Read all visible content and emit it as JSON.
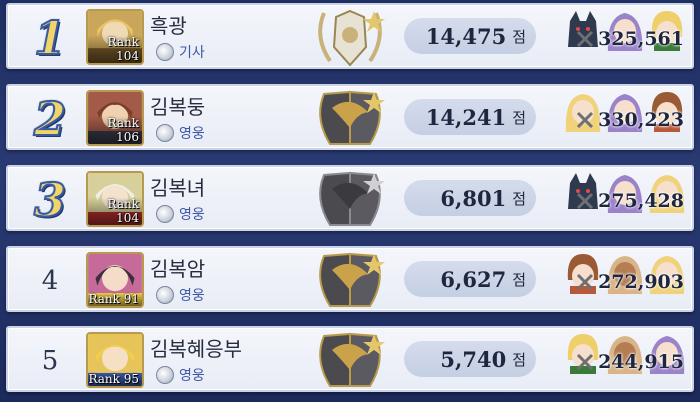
{
  "entries": [
    {
      "rank": "1",
      "name": "흑광",
      "title": "기사",
      "rank_label": "Rank 104",
      "score": "14,475",
      "unit": "점",
      "power": "325,561",
      "emblem": "gold-silver-crest",
      "party": [
        "dark-wolf-knight",
        "purple-hair-girl",
        "blonde-boy"
      ]
    },
    {
      "rank": "2",
      "name": "김복둥",
      "title": "영웅",
      "rank_label": "Rank 106",
      "score": "14,241",
      "unit": "점",
      "power": "330,223",
      "emblem": "dark-gold-crest",
      "party": [
        "blonde-girl",
        "purple-hair-girl",
        "brown-hair-boy"
      ]
    },
    {
      "rank": "3",
      "name": "김복녀",
      "title": "영웅",
      "rank_label": "Rank 104",
      "score": "6,801",
      "unit": "점",
      "power": "275,428",
      "emblem": "dark-gold-crest",
      "party": [
        "dark-wolf-knight",
        "purple-hair-girl",
        "blonde-girl"
      ]
    },
    {
      "rank": "4",
      "name": "김복암",
      "title": "영웅",
      "rank_label": "Rank 91",
      "score": "6,627",
      "unit": "점",
      "power": "272,903",
      "emblem": "dark-gold-crest",
      "party": [
        "brown-hair-boy",
        "tan-elf",
        "blonde-girl"
      ]
    },
    {
      "rank": "5",
      "name": "김복혜응부",
      "title": "영웅",
      "rank_label": "Rank 95",
      "score": "5,740",
      "unit": "점",
      "power": "244,915",
      "emblem": "dark-gold-crest",
      "party": [
        "blonde-boy",
        "tan-elf",
        "purple-hair-girl"
      ]
    }
  ],
  "colors": {
    "rank_gold": "#f1d46a",
    "panel": "#eef1f8",
    "accent": "#3a57a8"
  }
}
